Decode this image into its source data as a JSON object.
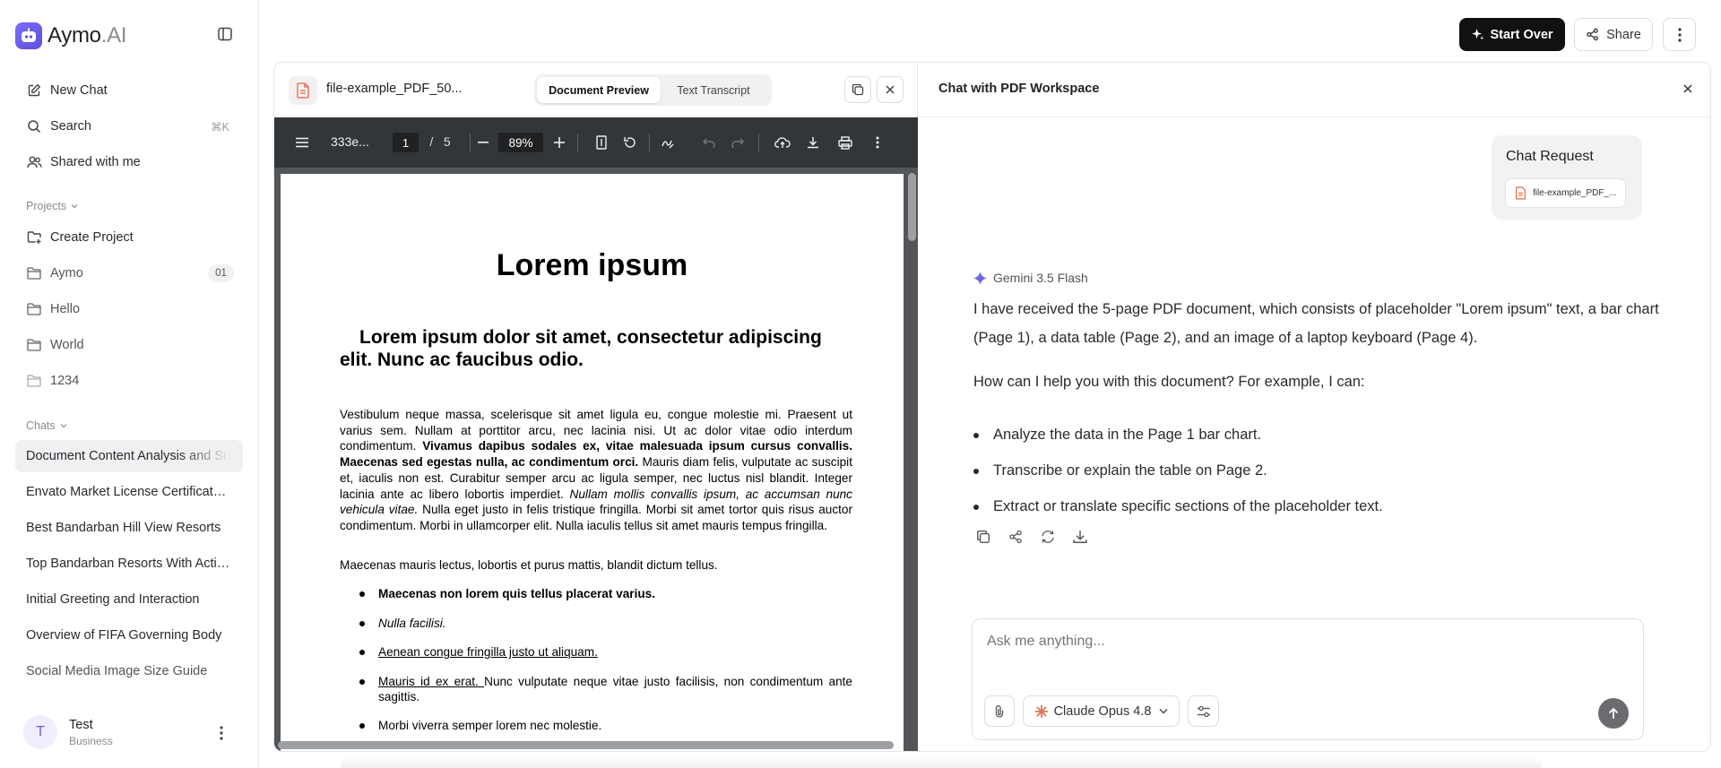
{
  "app": {
    "name_main": "Aymo",
    "name_suffix": ".AI"
  },
  "sidebar": {
    "nav": [
      {
        "label": "New Chat",
        "icon": "edit-icon"
      },
      {
        "label": "Search",
        "icon": "search-icon",
        "shortcut": "⌘K"
      },
      {
        "label": "Shared with me",
        "icon": "users-icon"
      }
    ],
    "projects_heading": "Projects",
    "create_project": "Create Project",
    "projects": [
      {
        "label": "Aymo",
        "badge": "01"
      },
      {
        "label": "Hello"
      },
      {
        "label": "World"
      },
      {
        "label": "1234"
      }
    ],
    "chats_heading": "Chats",
    "chats": [
      "Document Content Analysis and Summary",
      "Envato Market License Certificate Details",
      "Best Bandarban Hill View Resorts",
      "Top Bandarban Resorts With Activities",
      "Initial Greeting and Interaction",
      "Overview of FIFA Governing Body",
      "Social Media Image Size Guide"
    ],
    "user": {
      "initial": "T",
      "name": "Test",
      "plan": "Business"
    }
  },
  "topbar": {
    "start_over": "Start Over",
    "share": "Share"
  },
  "document": {
    "file_name": "file-example_PDF_50...",
    "tabs": [
      "Document Preview",
      "Text Transcript"
    ],
    "toolbar": {
      "title": "333e...",
      "page_current": "1",
      "page_total": "5",
      "zoom": "89%"
    },
    "page": {
      "title": "Lorem ipsum",
      "heading": "Lorem ipsum dolor sit amet, consectetur adipiscing elit. Nunc ac faucibus odio.",
      "para1_a": "Vestibulum neque massa, scelerisque sit amet ligula eu, congue molestie mi. Praesent ut varius sem. Nullam at porttitor arcu, nec lacinia nisi. Ut ac dolor vitae odio interdum condimentum. ",
      "para1_b": "Vivamus dapibus sodales ex, vitae malesuada ipsum cursus convallis. Maecenas sed egestas nulla, ac condimentum orci.",
      "para1_c": " Mauris diam felis, vulputate ac suscipit et, iaculis non est. Curabitur semper arcu ac ligula semper, nec luctus nisl blandit. Integer lacinia ante ac libero lobortis imperdiet. ",
      "para1_d": "Nullam mollis convallis ipsum, ac accumsan nunc vehicula vitae.",
      "para1_e": " Nulla eget justo in felis tristique fringilla. Morbi sit amet tortor quis risus auctor condimentum. Morbi in ullamcorper elit. Nulla iaculis tellus sit amet mauris tempus fringilla.",
      "para2": "Maecenas mauris lectus, lobortis et purus mattis, blandit dictum tellus.",
      "bullets": {
        "b1": "Maecenas non lorem quis tellus placerat varius.",
        "b2": "Nulla facilisi.",
        "b3": "Aenean congue fringilla justo ut aliquam. ",
        "b4_link": "Mauris id ex erat. ",
        "b4_rest": "Nunc vulputate neque vitae justo facilisis, non condimentum ante sagittis.",
        "b5": "Morbi viverra semper lorem nec molestie."
      }
    }
  },
  "chat": {
    "title": "Chat with PDF Workspace",
    "request": {
      "title": "Chat Request",
      "file": "file-example_PDF_..."
    },
    "model_name": "Gemini 3.5 Flash",
    "response_p1": "I have received the 5-page PDF document, which consists of placeholder \"Lorem ipsum\" text, a bar chart (Page 1), a data table (Page 2), and an image of a laptop keyboard (Page 4).",
    "response_p2": "How can I help you with this document? For example, I can:",
    "response_items": [
      "Analyze the data in the Page 1 bar chart.",
      "Transcribe or explain the table on Page 2.",
      "Extract or translate specific sections of the placeholder text."
    ],
    "composer": {
      "placeholder": "Ask me anything...",
      "model": "Claude Opus 4.8"
    }
  },
  "colors": {
    "accent": "#6b5fe0",
    "primary_button": "#111111",
    "pdf_toolbar": "#333639",
    "pdf_bg": "#525659"
  }
}
